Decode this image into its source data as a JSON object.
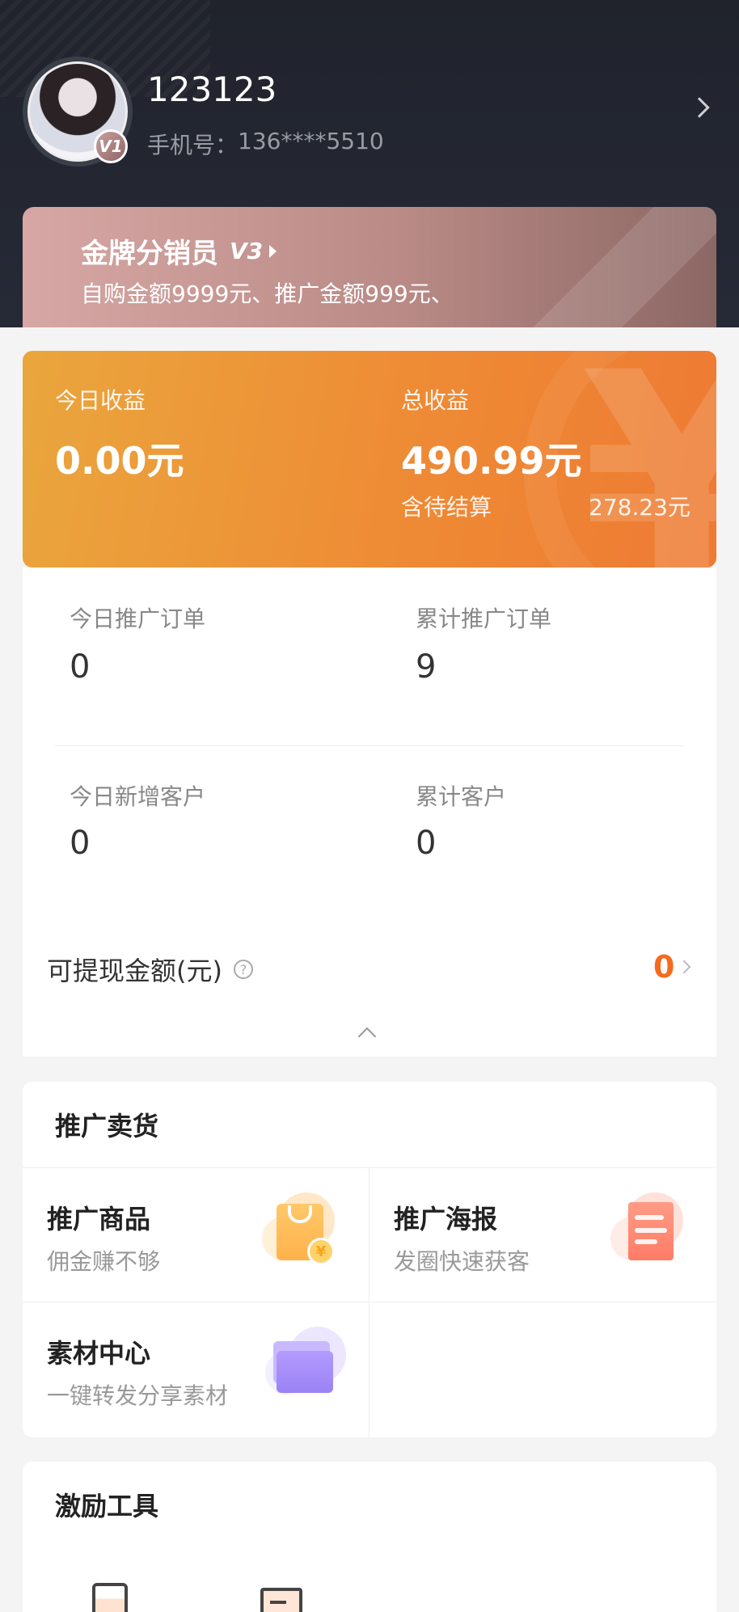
{
  "profile": {
    "username": "123123",
    "phone_label": "手机号：",
    "phone": "136****5510",
    "vip_badge": "V1"
  },
  "level": {
    "title": "金牌分销员",
    "tag": "V3",
    "description": "自购金额9999元、推广金额999元、"
  },
  "income": {
    "today_label": "今日收益",
    "today_value": "0.00元",
    "total_label": "总收益",
    "total_value": "490.99元",
    "pending_label": "含待结算",
    "pending_value": "278.23元"
  },
  "stats": {
    "today_orders_label": "今日推广订单",
    "today_orders_value": "0",
    "total_orders_label": "累计推广订单",
    "total_orders_value": "9",
    "today_customers_label": "今日新增客户",
    "today_customers_value": "0",
    "total_customers_label": "累计客户",
    "total_customers_value": "0",
    "withdraw_label": "可提现金额(元)",
    "withdraw_value": "0",
    "help_glyph": "?"
  },
  "promote": {
    "title": "推广卖货",
    "tiles": [
      {
        "title": "推广商品",
        "subtitle": "佣金赚不够",
        "icon": "shopping-bag-icon"
      },
      {
        "title": "推广海报",
        "subtitle": "发圈快速获客",
        "icon": "poster-icon"
      },
      {
        "title": "素材中心",
        "subtitle": "一键转发分享素材",
        "icon": "folder-icon"
      }
    ],
    "coin_glyph": "¥"
  },
  "incentive": {
    "title": "激励工具"
  },
  "colors": {
    "header_bg": "#20232c",
    "income_orange": "#ee8b35",
    "withdraw_orange": "#f56a1e"
  }
}
